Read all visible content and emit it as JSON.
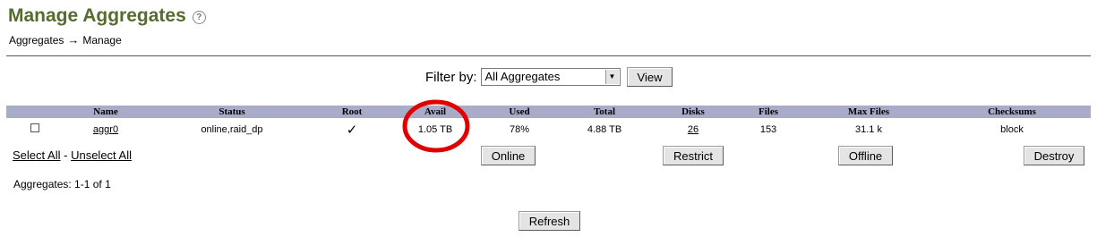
{
  "page": {
    "title": "Manage Aggregates",
    "help_icon": "?",
    "breadcrumb": {
      "parent": "Aggregates",
      "separator": "→",
      "current": "Manage"
    }
  },
  "filter": {
    "label": "Filter by:",
    "selected": "All Aggregates",
    "view_button": "View"
  },
  "table": {
    "headers": [
      "Name",
      "Status",
      "Root",
      "Avail",
      "Used",
      "Total",
      "Disks",
      "Files",
      "Max Files",
      "Checksums"
    ],
    "rows": [
      {
        "name": "aggr0",
        "status": "online,raid_dp",
        "root": "✓",
        "avail": "1.05 TB",
        "used": "78%",
        "total": "4.88 TB",
        "disks": "26",
        "files": "153",
        "max_files": "31.1 k",
        "checksums": "block",
        "checked": false
      }
    ]
  },
  "actions": {
    "select_all": "Select All",
    "separator": "-",
    "unselect_all": "Unselect All",
    "online": "Online",
    "restrict": "Restrict",
    "offline": "Offline",
    "destroy": "Destroy"
  },
  "pagination": {
    "summary": "Aggregates: 1-1 of 1"
  },
  "refresh_button": "Refresh",
  "colors": {
    "title": "#556b2f",
    "header_bg": "#a9acc8",
    "annotation": "#e00000"
  }
}
